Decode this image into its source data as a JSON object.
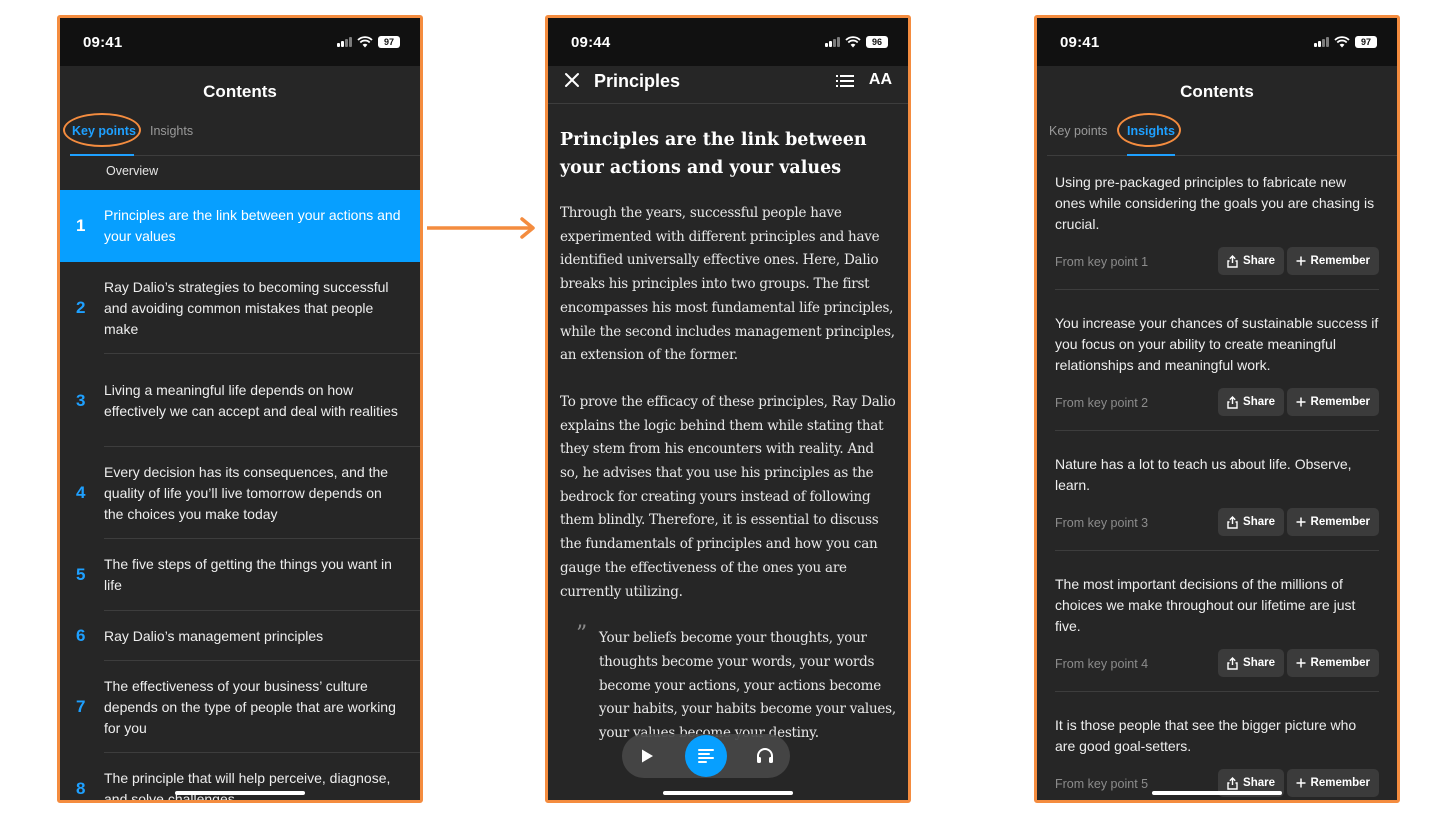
{
  "colors": {
    "accent": "#079fff",
    "annotation": "#f48c3f",
    "background": "#262626"
  },
  "phone1": {
    "status": {
      "time": "09:41",
      "battery": "97"
    },
    "title": "Contents",
    "tabs": [
      {
        "label": "Key points",
        "active": true
      },
      {
        "label": "Insights",
        "active": false
      }
    ],
    "overview": "Overview",
    "items": [
      {
        "number": "1",
        "text": "Principles are the link between your actions and your values"
      },
      {
        "number": "2",
        "text": "Ray Dalio’s strategies to becoming successful and avoiding common mistakes that people make"
      },
      {
        "number": "3",
        "text": "Living a meaningful life depends on how effectively we can accept and deal with realities"
      },
      {
        "number": "4",
        "text": "Every decision has its consequences, and the quality of life you’ll live tomorrow depends on the choices you make today"
      },
      {
        "number": "5",
        "text": "The five steps of getting the things you want in life"
      },
      {
        "number": "6",
        "text": "Ray Dalio’s management principles"
      },
      {
        "number": "7",
        "text": "The effectiveness of your business’ culture depends on the type of people that are working for you"
      },
      {
        "number": "8",
        "text": "The principle that will help perceive, diagnose, and solve challenges"
      }
    ]
  },
  "phone2": {
    "status": {
      "time": "09:44",
      "battery": "96"
    },
    "header_title": "Principles",
    "font_button": "AA",
    "heading": "Principles are the link between your actions and your values",
    "paragraphs": [
      "Through the years, successful people have experimented with different principles and have identified universally effective ones. Here, Dalio breaks his principles into two groups. The first encompasses his most fundamental life principles, while the second includes management principles, an extension of the former.",
      "To prove the efficacy of these principles, Ray Dalio explains the logic behind them while stating that they stem from his encounters with reality. And so, he advises that you use his principles as the bedrock for creating yours instead of following them blindly. Therefore, it is essential to discuss the fundamentals of principles and how you can gauge the effectiveness of the ones you are currently utilizing."
    ],
    "quote_mark": "”",
    "quote": "Your beliefs become your thoughts, your thoughts become your words, your words become your actions, your actions become your habits, your habits become your values, your values become your destiny."
  },
  "phone3": {
    "status": {
      "time": "09:41",
      "battery": "97"
    },
    "title": "Contents",
    "tabs": [
      {
        "label": "Key points",
        "active": false
      },
      {
        "label": "Insights",
        "active": true
      }
    ],
    "share_label": "Share",
    "remember_label": "Remember",
    "insights": [
      {
        "text": "Using pre-packaged principles to fabricate new ones while considering the goals you are chasing is crucial.",
        "from": "From key point 1"
      },
      {
        "text": "You increase your chances of sustainable success if you focus on your ability to create meaningful relationships and meaningful work.",
        "from": "From key point 2"
      },
      {
        "text": "Nature has a lot to teach us about life. Observe, learn.",
        "from": "From key point 3"
      },
      {
        "text": "The most important decisions of the millions of choices we make throughout our lifetime are just five.",
        "from": "From key point 4"
      },
      {
        "text": "It is those people that see the bigger picture who are good goal-setters.",
        "from": "From key point 5"
      }
    ]
  }
}
